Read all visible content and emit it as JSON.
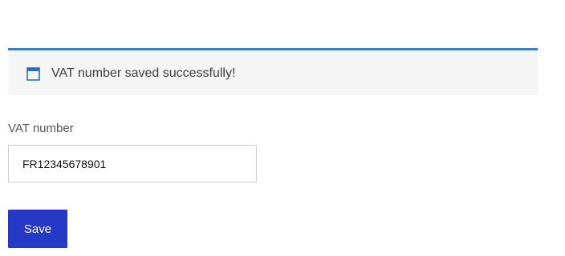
{
  "notice": {
    "icon": "window-icon",
    "message": "VAT number saved successfully!",
    "accent_color": "#3a7dc4",
    "icon_color": "#2f6db8"
  },
  "form": {
    "vat_label": "VAT number",
    "vat_value": "FR12345678901",
    "save_label": "Save",
    "button_color": "#2538c6"
  }
}
